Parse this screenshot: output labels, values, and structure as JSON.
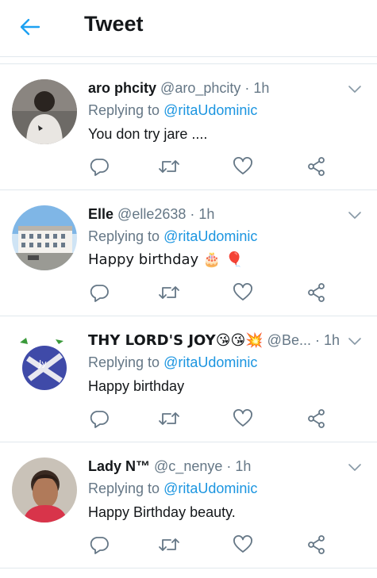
{
  "header": {
    "title": "Tweet",
    "back_icon": "arrow-left-icon",
    "accent": "#1da1f2"
  },
  "colors": {
    "link": "#1b95e0",
    "muted": "#657786",
    "divider": "#e1e8ed",
    "text": "#14171a"
  },
  "tweets": [
    {
      "name": "aro phcity",
      "handle": "@aro_phcity",
      "sep": "·",
      "time": "1h",
      "replying_prefix": "Replying to",
      "replying_to": "@ritaUdominic",
      "text": "You don try jare ...."
    },
    {
      "name": "Elle",
      "handle": "@elle2638",
      "sep": "·",
      "time": "1h",
      "replying_prefix": "Replying to",
      "replying_to": "@ritaUdominic",
      "text": "Happy birthday 🎂 🎈"
    },
    {
      "name": "THY LORD'S JOY😘😘💥",
      "handle": "@Be...",
      "sep": "·",
      "time": "1h",
      "replying_prefix": "Replying to",
      "replying_to": "@ritaUdominic",
      "text": "Happy birthday"
    },
    {
      "name": "Lady N™",
      "handle": "@c_nenye",
      "sep": "·",
      "time": "1h",
      "replying_prefix": "Replying to",
      "replying_to": "@ritaUdominic",
      "text": "Happy Birthday beauty."
    }
  ],
  "action_icons": [
    "reply-icon",
    "retweet-icon",
    "like-icon",
    "share-icon"
  ]
}
